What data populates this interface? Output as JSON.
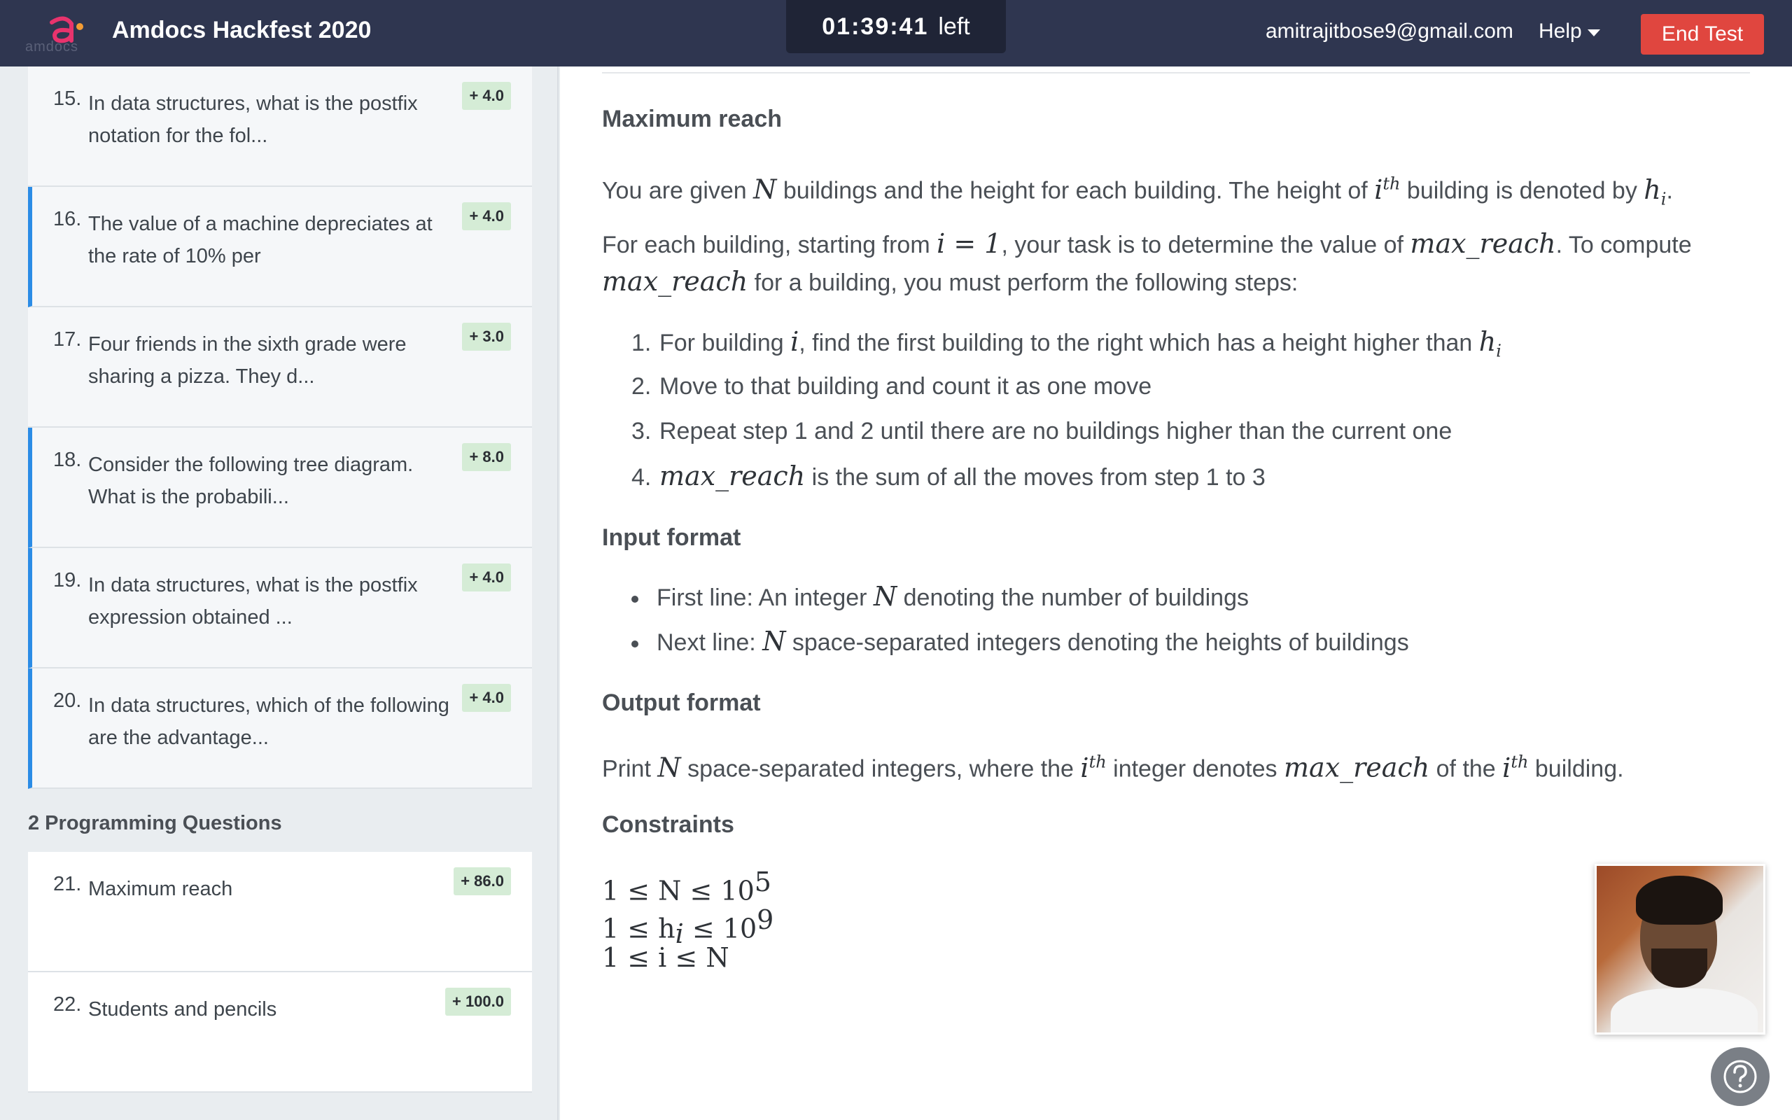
{
  "header": {
    "logo_text": "amdocs",
    "title": "Amdocs Hackfest 2020",
    "timer_value": "01:39:41",
    "timer_suffix": "left",
    "email": "amitrajitbose9@gmail.com",
    "help_label": "Help",
    "end_test_label": "End Test",
    "accent_color": "#e0463f"
  },
  "sidebar": {
    "questions": [
      {
        "num": "15.",
        "text": "In data structures, what is the postfix notation for the fol...",
        "score": "+ 4.0"
      },
      {
        "num": "16.",
        "text": "The value of a machine depreciates at the rate of 10% per",
        "score": "+ 4.0"
      },
      {
        "num": "17.",
        "text": "Four friends in the sixth grade were sharing a pizza. They d...",
        "score": "+ 3.0"
      },
      {
        "num": "18.",
        "text": "Consider the following tree diagram. What is the probabili...",
        "score": "+ 8.0"
      },
      {
        "num": "19.",
        "text": "In data structures, what is the postfix expression obtained ...",
        "score": "+ 4.0"
      },
      {
        "num": "20.",
        "text": "In data structures, which of the following are the advantage...",
        "score": "+ 4.0"
      }
    ],
    "programming_section": "2 Programming Questions",
    "programming": [
      {
        "num": "21.",
        "text": "Maximum reach",
        "score": "+ 86.0"
      },
      {
        "num": "22.",
        "text": "Students and pencils",
        "score": "+ 100.0"
      }
    ]
  },
  "problem": {
    "title": "Maximum reach",
    "intro_a": "You are given",
    "intro_b": "buildings and the height for each building. The height of",
    "intro_c": "building is denoted by",
    "task_a": "For each building, starting from",
    "task_b": ", your task is to determine the value of",
    "task_c": ". To compute",
    "task_d": "for a building, you must perform the following steps:",
    "steps": [
      "For building",
      ", find the first building to the right which has a height higher than",
      "Move to that building and count it as one move",
      "Repeat step 1 and 2 until there are no buildings higher than the current one",
      "is the sum of all the moves from step 1 to 3"
    ],
    "input_title": "Input format",
    "input_1a": "First line: An integer",
    "input_1b": "denoting the number of buildings",
    "input_2a": "Next line:",
    "input_2b": "space-separated integers denoting the heights of buildings",
    "output_title": "Output format",
    "output_a": "Print",
    "output_b": "space-separated integers, where the",
    "output_c": "integer denotes",
    "output_d": "of the",
    "output_e": "building.",
    "constraints_title": "Constraints",
    "math": {
      "N": "N",
      "i": "i",
      "h": "h",
      "th": "th",
      "i_eq_1": "i = 1",
      "max_reach": "max_reach",
      "c1": "1 ≤ N ≤ 10",
      "c1_exp": "5",
      "c2a": "1 ≤ h",
      "c2b": " ≤ 10",
      "c2_exp": "9",
      "c3": "1 ≤ i ≤ N"
    }
  }
}
